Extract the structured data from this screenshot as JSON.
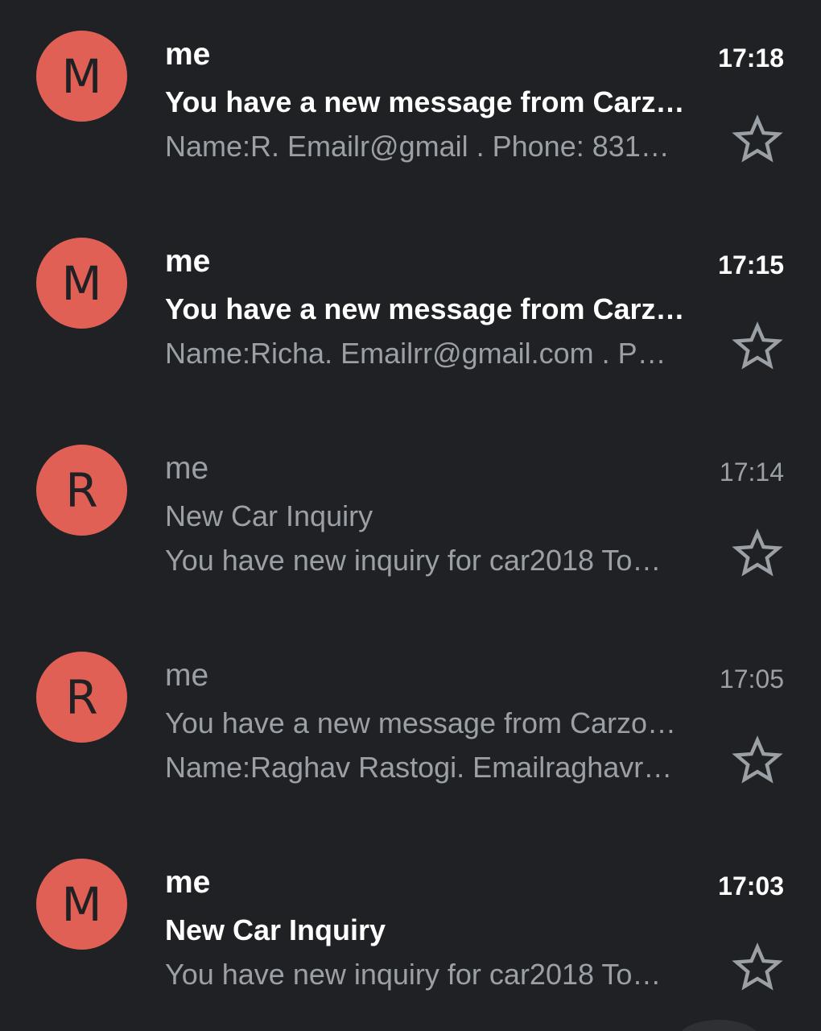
{
  "emails": [
    {
      "avatar_letter": "M",
      "sender": "me",
      "time": "17:18",
      "subject": "You have a new message from Carz…",
      "snippet": "Name:R. Emailr@gmail . Phone: 831…",
      "unread": true,
      "starred": false
    },
    {
      "avatar_letter": "M",
      "sender": "me",
      "time": "17:15",
      "subject": "You have a new message from Carz…",
      "snippet": "Name:Richa. Emailrr@gmail.com . P…",
      "unread": true,
      "starred": false
    },
    {
      "avatar_letter": "R",
      "sender": "me",
      "time": "17:14",
      "subject": "New Car Inquiry",
      "snippet": "You have new inquiry for car2018 To…",
      "unread": false,
      "starred": false
    },
    {
      "avatar_letter": "R",
      "sender": "me",
      "time": "17:05",
      "subject": "You have a new message from Carzo…",
      "snippet": "Name:Raghav Rastogi. Emailraghavr…",
      "unread": false,
      "starred": false
    },
    {
      "avatar_letter": "M",
      "sender": "me",
      "time": "17:03",
      "subject": "New Car Inquiry",
      "snippet": "You have new inquiry for car2018 To…",
      "unread": true,
      "starred": false
    }
  ],
  "icons": {
    "star": "star-outline-icon"
  },
  "colors": {
    "background": "#202124",
    "avatar": "#e06055",
    "unread_text": "#ffffff",
    "read_text": "#9aa0a6",
    "star": "#9aa0a6"
  }
}
